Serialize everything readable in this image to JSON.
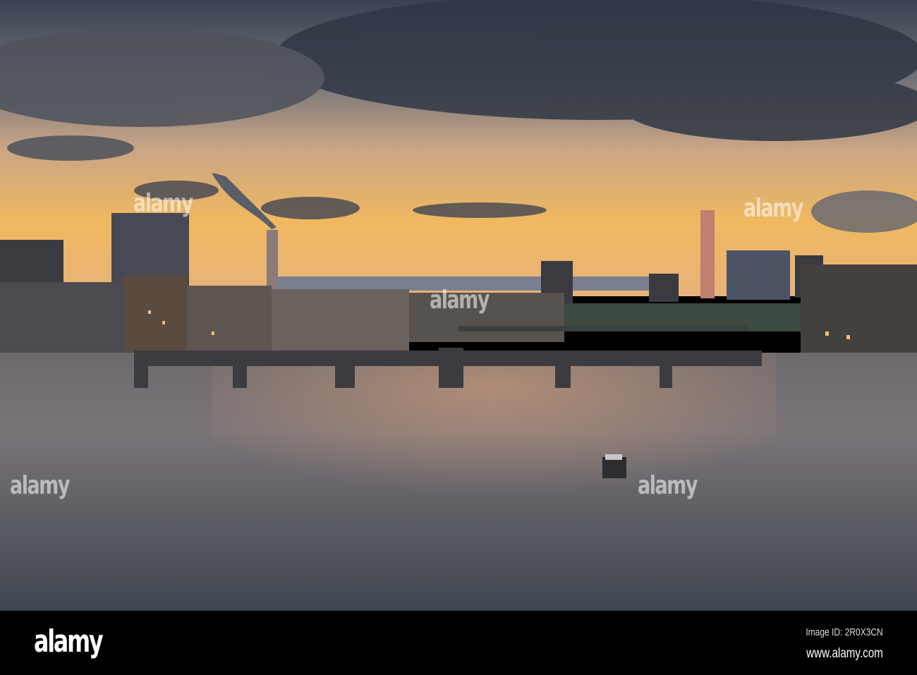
{
  "watermark": {
    "logo": "alamy",
    "image_id": "Image ID: 2R0X3CN",
    "url": "www.alamy.com"
  },
  "colors": {
    "sky_top": "#3b4452",
    "horizon": "#f5b35a",
    "water": "#5e6572",
    "bar": "#000000"
  }
}
